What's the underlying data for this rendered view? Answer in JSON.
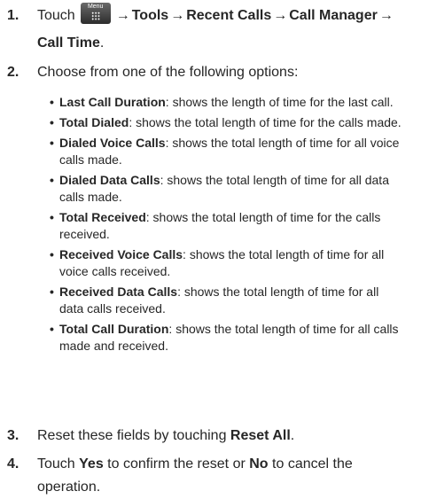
{
  "steps": [
    {
      "number": "1.",
      "prefix": "Touch",
      "icon": {
        "name": "menu-icon",
        "label": "Menu"
      },
      "path": [
        "Tools",
        "Recent Calls",
        "Call Manager",
        "Call Time"
      ],
      "suffix": ".",
      "arrow": "→"
    },
    {
      "number": "2.",
      "text": "Choose from one of the following options:",
      "options": [
        {
          "term": "Last Call Duration",
          "desc": ": shows the length of time for the last call."
        },
        {
          "term": "Total Dialed",
          "desc": ": shows the total length of time for the calls made."
        },
        {
          "term": "Dialed Voice Calls",
          "desc": ": shows the total length of time for all voice calls made."
        },
        {
          "term": "Dialed Data Calls",
          "desc": ": shows the total length of time for all data calls made."
        },
        {
          "term": "Total Received",
          "desc": ": shows the total length of time for the calls received."
        },
        {
          "term": "Received Voice Calls",
          "desc": ": shows the total length of time for all voice calls received."
        },
        {
          "term": "Received Data Calls",
          "desc": ": shows the total length of time for all data calls received."
        },
        {
          "term": "Total Call Duration",
          "desc": ": shows the total length of time for all calls made and received."
        }
      ]
    },
    {
      "number": "3.",
      "before": "Reset these fields by touching ",
      "bold": "Reset All",
      "after": "."
    },
    {
      "number": "4.",
      "t1": "Touch ",
      "yes": "Yes",
      "t2": " to confirm the reset or ",
      "no": "No",
      "t3": " to cancel the operation."
    }
  ]
}
